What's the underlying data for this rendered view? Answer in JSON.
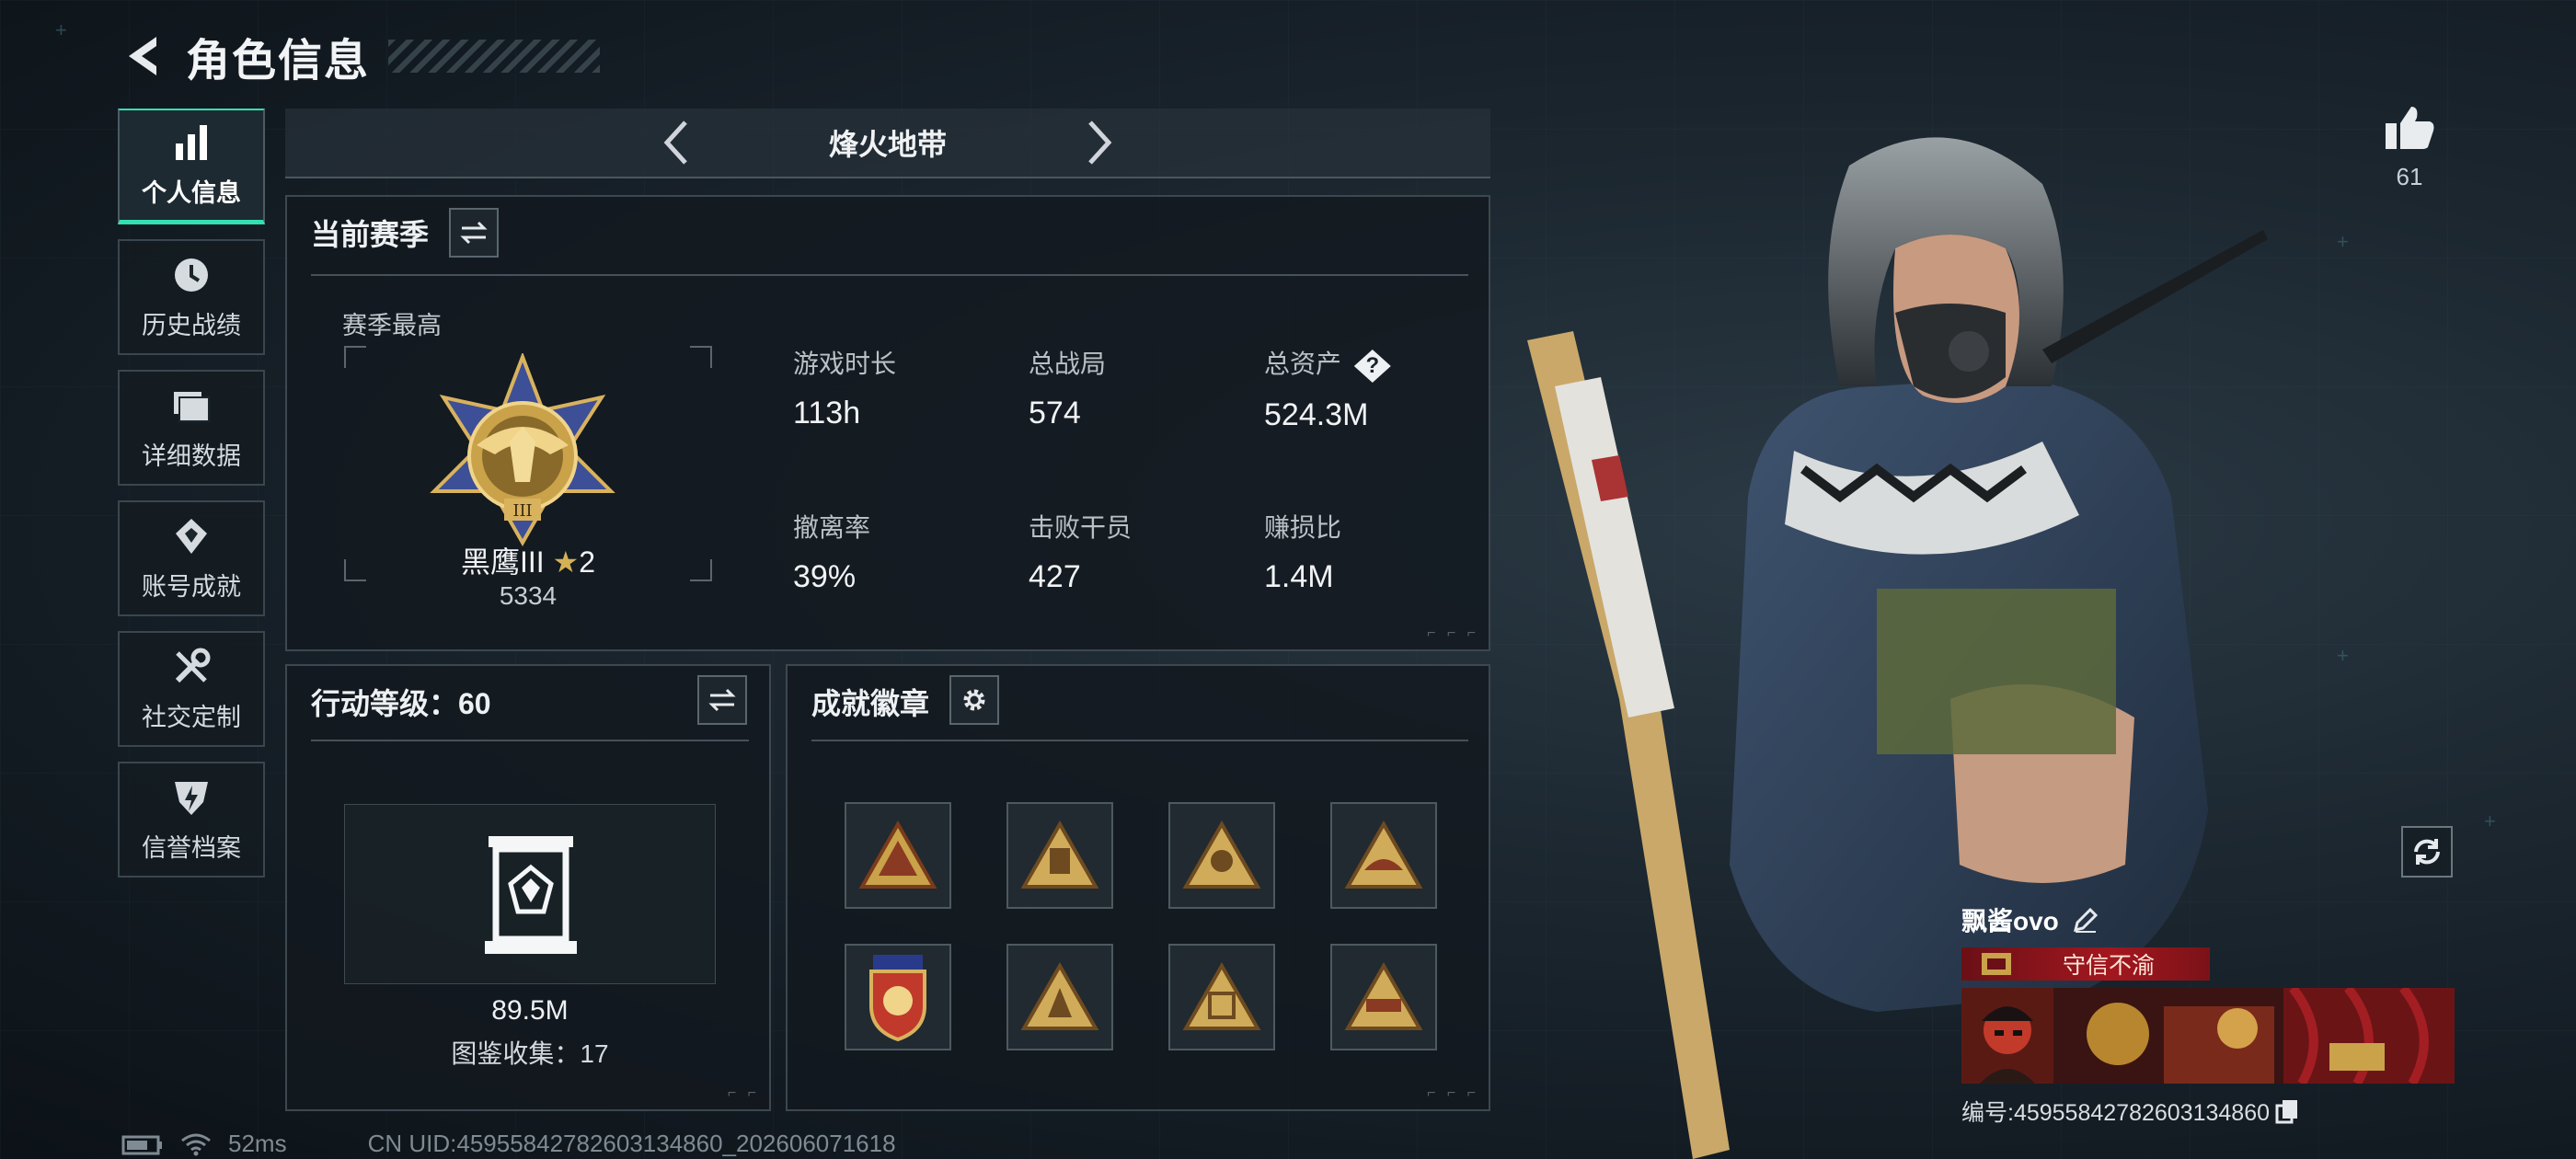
{
  "header": {
    "title": "角色信息"
  },
  "sidebar": {
    "items": [
      {
        "label": "个人信息",
        "icon": "bar-chart-icon",
        "active": true
      },
      {
        "label": "历史战绩",
        "icon": "history-clock-icon"
      },
      {
        "label": "详细数据",
        "icon": "folder-icon"
      },
      {
        "label": "账号成就",
        "icon": "achievement-icon"
      },
      {
        "label": "社交定制",
        "icon": "tools-icon"
      },
      {
        "label": "信誉档案",
        "icon": "credit-shield-icon"
      }
    ]
  },
  "mode": {
    "title": "烽火地带"
  },
  "season": {
    "title": "当前赛季",
    "best_label": "赛季最高",
    "rank_name": "黑鹰III",
    "rank_stars": "2",
    "rank_points": "5334",
    "stats": [
      {
        "label": "游戏时长",
        "value": "113h"
      },
      {
        "label": "总战局",
        "value": "574"
      },
      {
        "label": "总资产",
        "value": "524.3M",
        "help": "?"
      },
      {
        "label": "撤离率",
        "value": "39%"
      },
      {
        "label": "击败干员",
        "value": "427"
      },
      {
        "label": "赚损比",
        "value": "1.4M"
      }
    ]
  },
  "action_level": {
    "title": "行动等级：60",
    "value": "89.5M",
    "collection": "图鉴收集：17"
  },
  "achievements": {
    "title": "成就徽章",
    "badges": [
      "badge-1",
      "badge-2",
      "badge-3",
      "badge-4",
      "badge-5",
      "badge-6",
      "badge-7",
      "badge-8"
    ]
  },
  "likes": {
    "count": "61"
  },
  "player": {
    "name": "飘酱ovo",
    "tag": "守信不渝",
    "uid_label": "编号:4595584278260313486​0"
  },
  "status": {
    "ping": "52ms",
    "uid_line": "CN UID:4595584278260313486​0_202606071618"
  },
  "colors": {
    "accent": "#33e0b2",
    "gold": "#c9a24a",
    "tag_red": "#a3171f"
  }
}
